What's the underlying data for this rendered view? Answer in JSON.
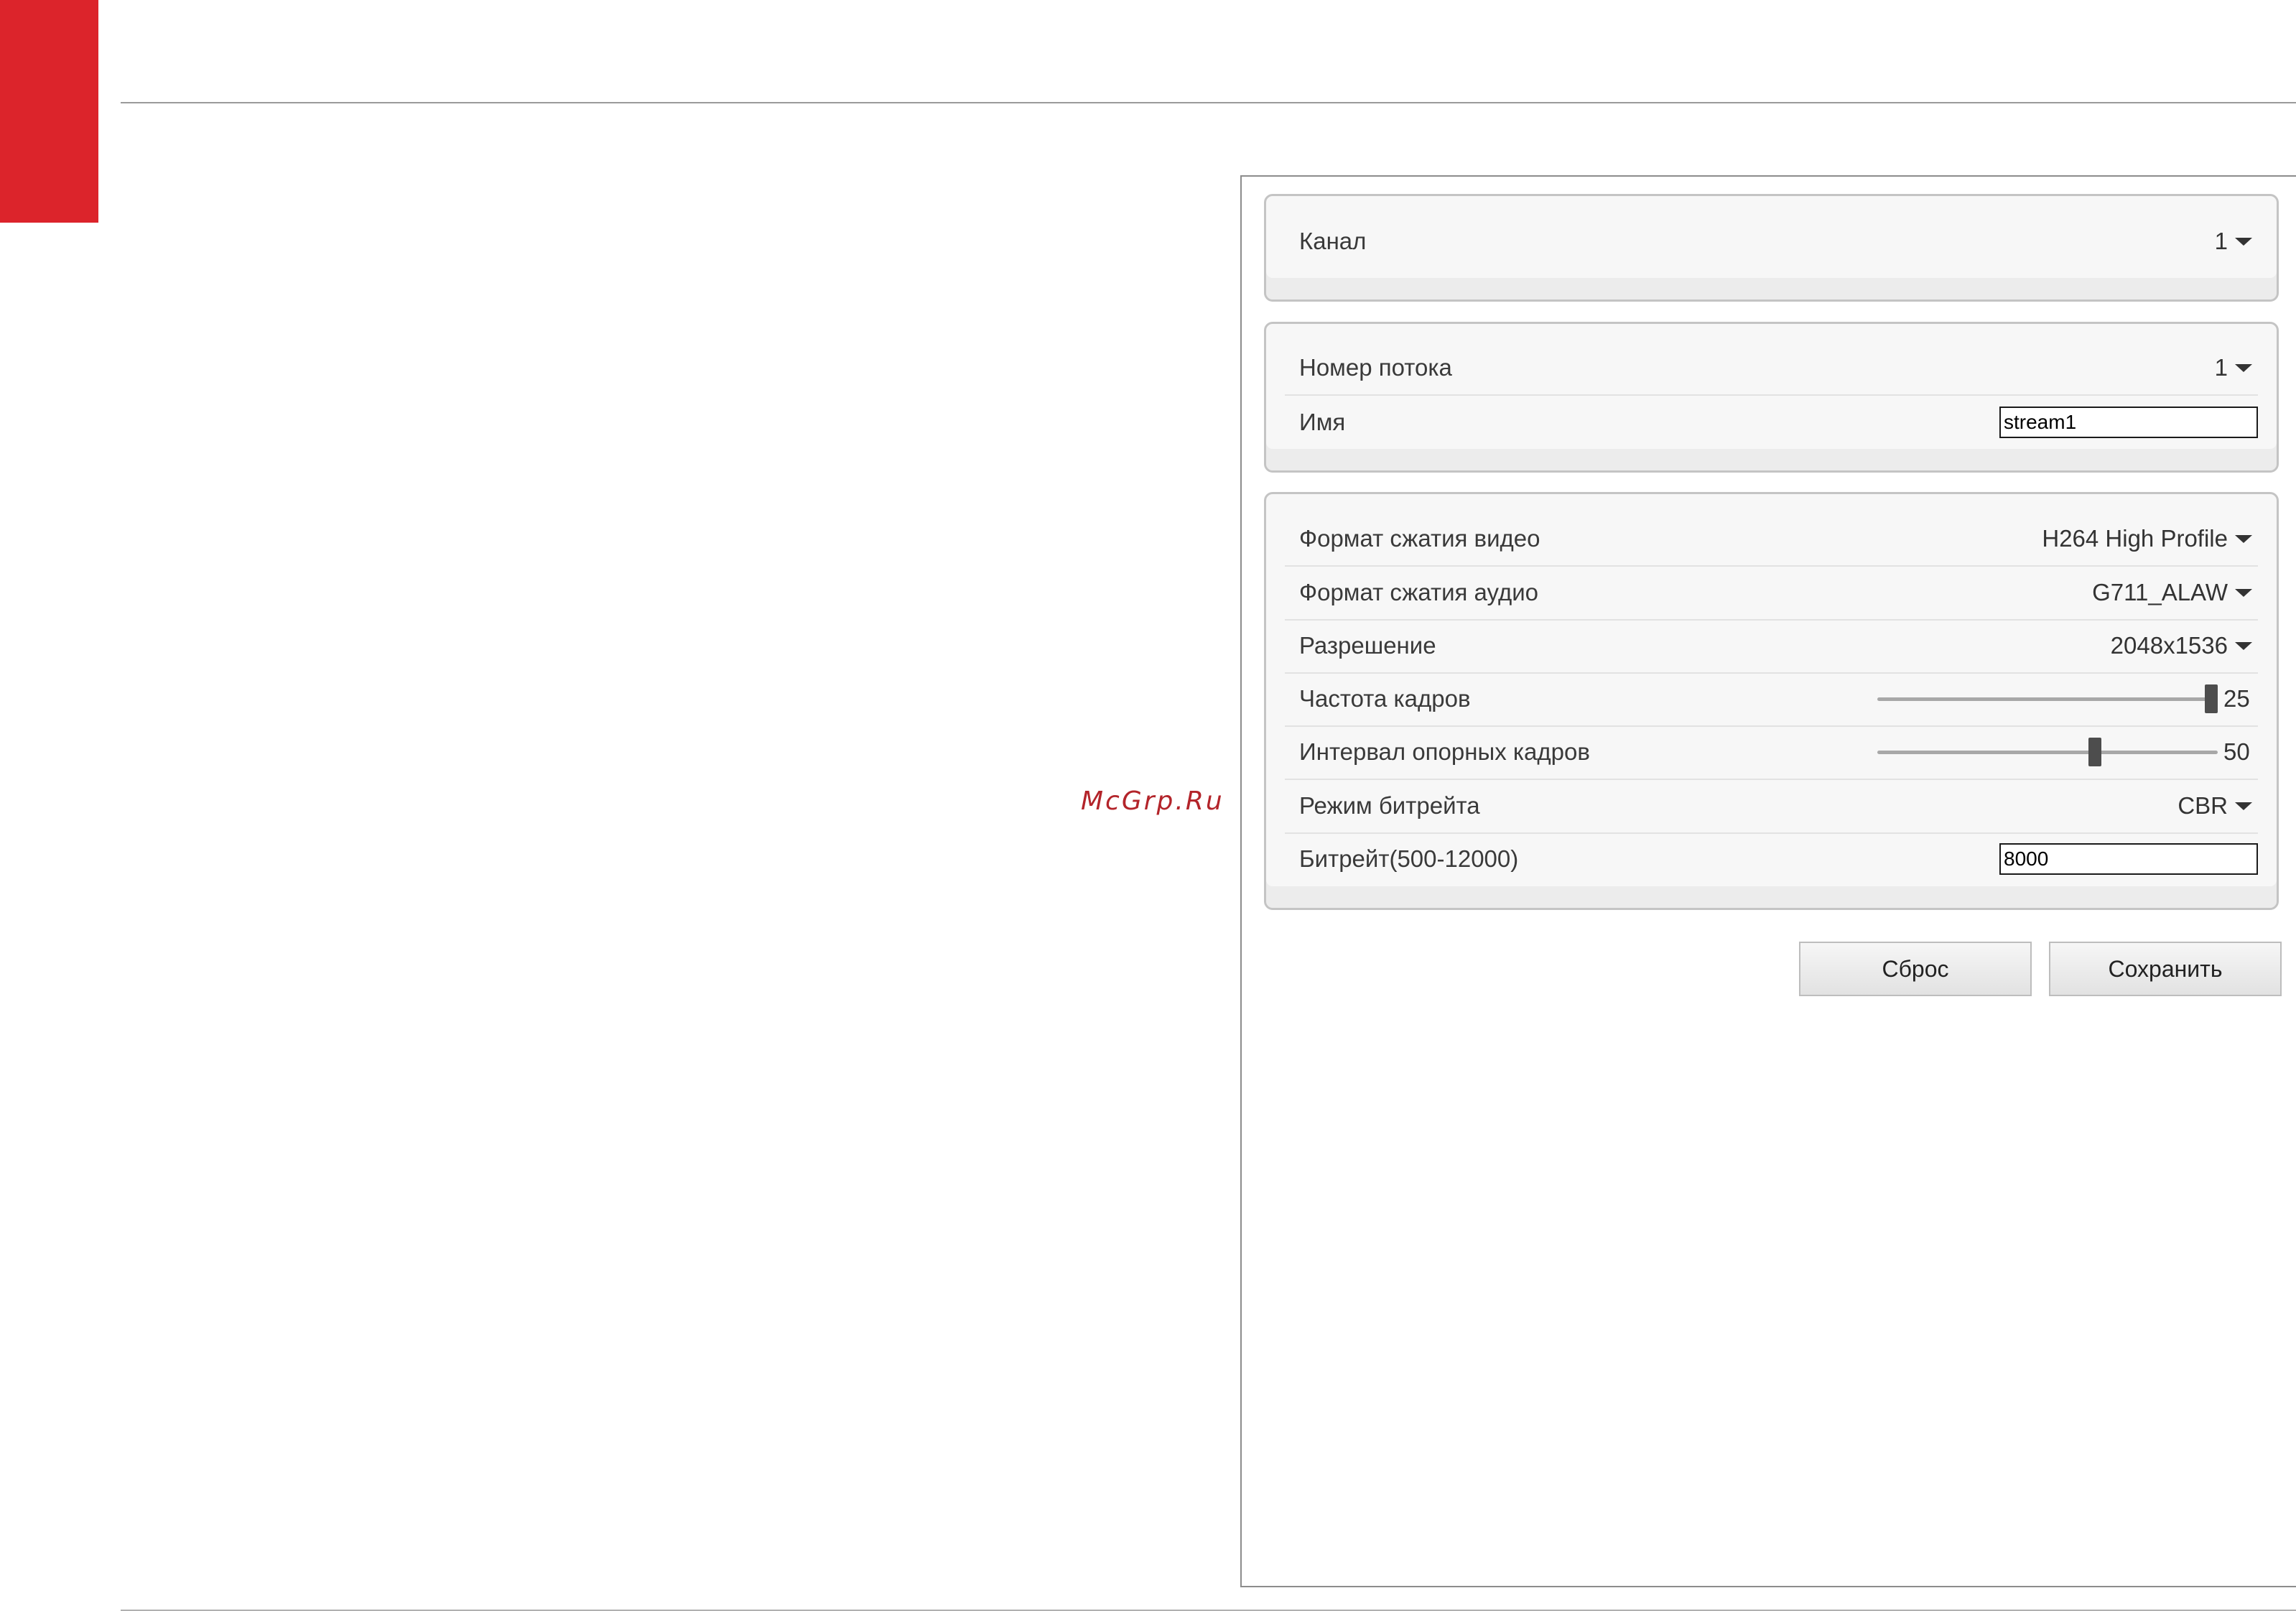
{
  "brand": {
    "accent_color": "#dc242b"
  },
  "watermark": {
    "text": "McGrp.Ru"
  },
  "channel_panel": {
    "channel": {
      "label": "Канал",
      "value": "1"
    }
  },
  "stream_panel": {
    "stream_number": {
      "label": "Номер потока",
      "value": "1"
    },
    "name": {
      "label": "Имя",
      "value": "stream1"
    }
  },
  "encoding_panel": {
    "video_codec": {
      "label": "Формат сжатия видео",
      "value": "H264 High Profile"
    },
    "audio_codec": {
      "label": "Формат сжатия аудио",
      "value": "G711_ALAW"
    },
    "resolution": {
      "label": "Разрешение",
      "value": "2048x1536"
    },
    "frame_rate": {
      "label": "Частота кадров",
      "value": "25",
      "level": 1.0
    },
    "iframe_interval": {
      "label": "Интервал опорных кадров",
      "value": "50",
      "level": 0.64
    },
    "bitrate_mode": {
      "label": "Режим битрейта",
      "value": "CBR"
    },
    "bitrate": {
      "label": "Битрейт(500-12000)",
      "value": "8000"
    }
  },
  "actions": {
    "reset_label": "Сброс",
    "save_label": "Сохранить"
  }
}
